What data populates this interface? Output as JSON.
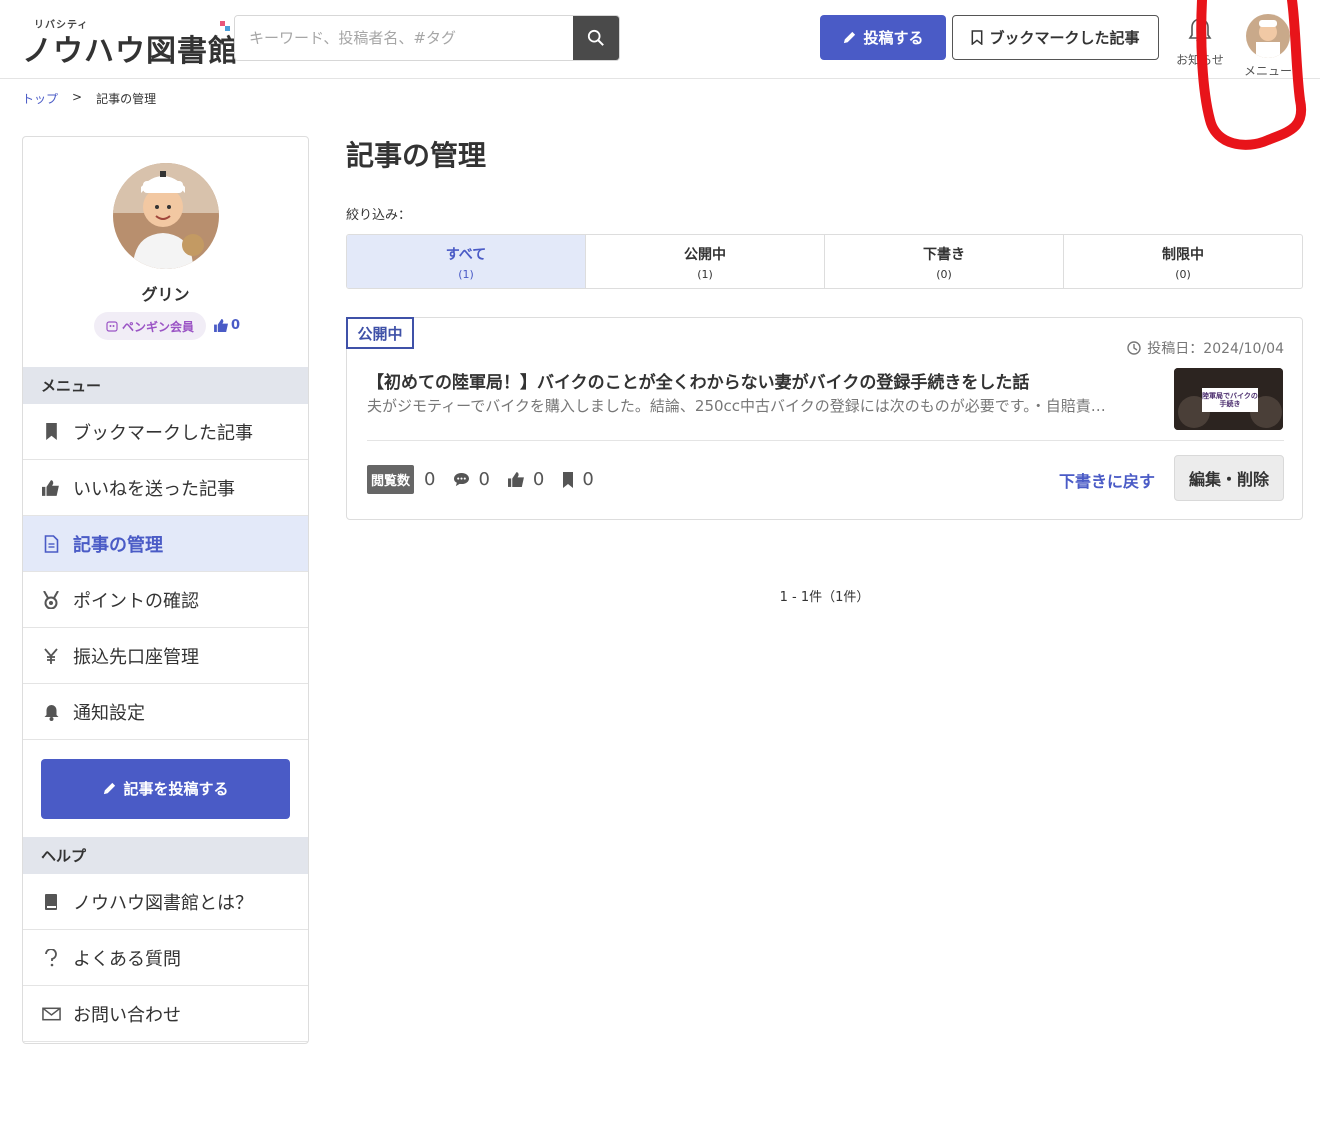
{
  "header": {
    "logo_tagline": "リバシティ",
    "logo_name": "ノウハウ図書館",
    "search_placeholder": "キーワード、投稿者名、#タグ",
    "post_button": "投稿する",
    "bookmark_button": "ブックマークした記事",
    "notifications_label": "お知らせ",
    "menu_label": "メニュー"
  },
  "breadcrumb": {
    "home": "トップ",
    "sep": ">",
    "current": "記事の管理"
  },
  "profile": {
    "name": "グリン",
    "member_badge": "ペンギン会員",
    "likes": "0"
  },
  "sidebar": {
    "menu_heading": "メニュー",
    "items": [
      {
        "label": "ブックマークした記事",
        "icon": "bookmark-icon"
      },
      {
        "label": "いいねを送った記事",
        "icon": "thumbs-up-icon"
      },
      {
        "label": "記事の管理",
        "icon": "document-icon",
        "active": true
      },
      {
        "label": "ポイントの確認",
        "icon": "medal-icon"
      },
      {
        "label": "振込先口座管理",
        "icon": "yen-icon"
      },
      {
        "label": "通知設定",
        "icon": "bell-icon"
      }
    ],
    "post_button": "記事を投稿する",
    "help_heading": "ヘルプ",
    "help_items": [
      {
        "label": "ノウハウ図書館とは？",
        "icon": "book-icon"
      },
      {
        "label": "よくある質問",
        "icon": "question-icon"
      },
      {
        "label": "お問い合わせ",
        "icon": "mail-icon"
      }
    ]
  },
  "main": {
    "title": "記事の管理",
    "filter_label": "絞り込み：",
    "tabs": [
      {
        "label": "すべて",
        "count": "(1)",
        "active": true
      },
      {
        "label": "公開中",
        "count": "(1)"
      },
      {
        "label": "下書き",
        "count": "(0)"
      },
      {
        "label": "制限中",
        "count": "(0)"
      }
    ],
    "article": {
      "status": "公開中",
      "date": "投稿日：2024/10/04",
      "title": "【初めての陸軍局！】バイクのことが全くわからない妻がバイクの登録手続きをした話",
      "excerpt": "夫がジモティーでバイクを購入しました。結論、250cc中古バイクの登録には次のものが必要です。・自賠責…",
      "thumb_label": "陸軍局でバイクの手続き",
      "views_label": "閲覧数",
      "views": "0",
      "comments": "0",
      "likes": "0",
      "bookmarks": "0",
      "to_draft": "下書きに戻す",
      "edit_delete": "編集・削除"
    },
    "pagination": "1 - 1件（1件）"
  },
  "colors": {
    "accent": "#4a5bc6",
    "active_bg": "#e3e9f9",
    "section_bg": "#e2e5ec",
    "scribble": "#e8141a"
  }
}
